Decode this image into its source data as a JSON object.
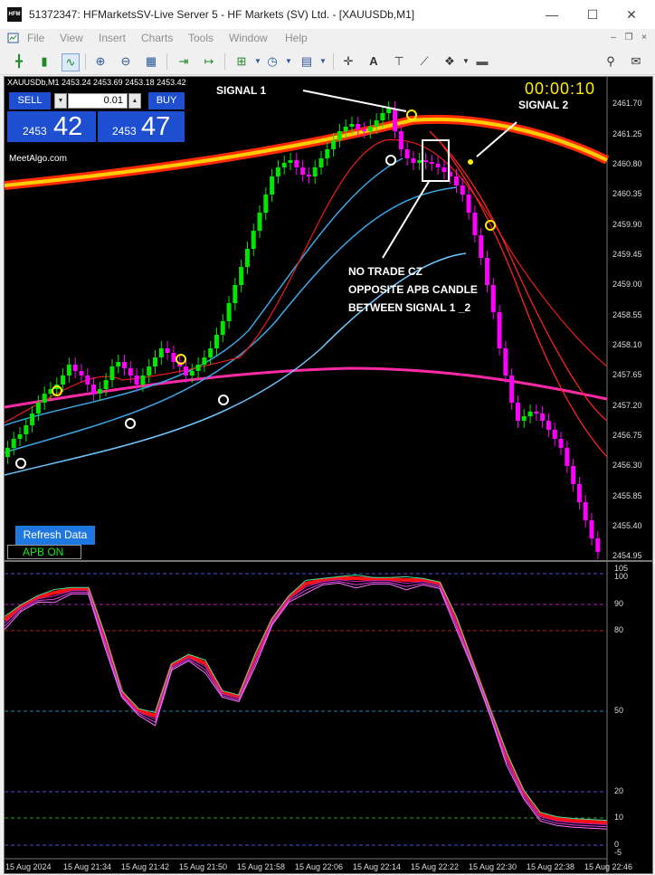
{
  "window": {
    "title": "51372347: HFMarketsSV-Live Server 5 - HF Markets (SV) Ltd. - [XAUUSDb,M1]",
    "app_icon": "HFM"
  },
  "menu": [
    "File",
    "View",
    "Insert",
    "Charts",
    "Tools",
    "Window",
    "Help"
  ],
  "chart": {
    "symbol_info": "XAUUSDb,M1  2453.24 2453.69 2453.18 2453.42",
    "watermark": "MeetAlgo.com",
    "timer": "00:00:10",
    "trade_panel": {
      "sell_label": "SELL",
      "buy_label": "BUY",
      "volume": "0.01",
      "bid_prefix": "2453",
      "bid_digits": "42",
      "ask_prefix": "2453",
      "ask_digits": "47"
    },
    "annotations": {
      "signal1": "SIGNAL 1",
      "signal2": "SIGNAL 2",
      "note_line1": "NO TRADE CZ",
      "note_line2": "OPPOSITE APB CANDLE",
      "note_line3": "BETWEEN SIGNAL 1 _2"
    },
    "buttons": {
      "refresh": "Refresh Data",
      "apb_status": "APB ON"
    },
    "price_axis": [
      "2461.70",
      "2461.25",
      "2460.80",
      "2460.35",
      "2459.90",
      "2459.45",
      "2459.00",
      "2458.55",
      "2458.10",
      "2457.65",
      "2457.20",
      "2456.75",
      "2456.30",
      "2455.85",
      "2455.40",
      "2454.95"
    ],
    "indicator_axis": [
      "105",
      "100",
      "90",
      "80",
      "50",
      "20",
      "10",
      "0",
      "-5"
    ],
    "time_axis": [
      "15 Aug 2024",
      "15 Aug 21:34",
      "15 Aug 21:42",
      "15 Aug 21:50",
      "15 Aug 21:58",
      "15 Aug 22:06",
      "15 Aug 22:14",
      "15 Aug 22:22",
      "15 Aug 22:30",
      "15 Aug 22:38",
      "15 Aug 22:46"
    ],
    "colors": {
      "bull": "#00e600",
      "bear": "#ff00ff",
      "signal": "#ffee00",
      "band_ma": "#ff2020",
      "slow_ma": "#ff2aa5",
      "channel": "#4fc3f7"
    }
  }
}
